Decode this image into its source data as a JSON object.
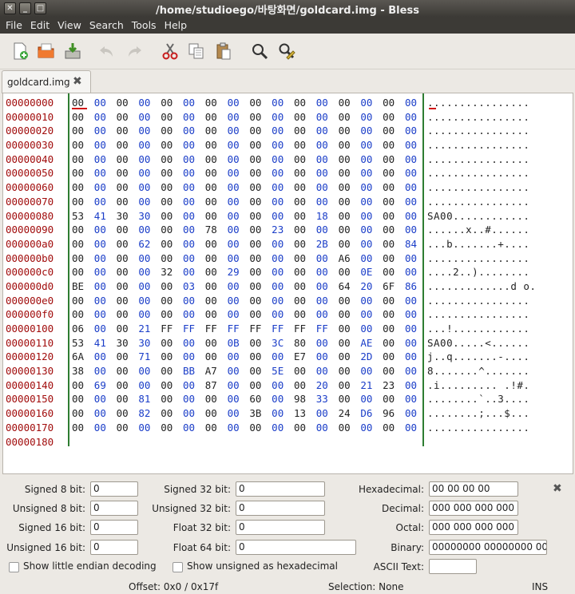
{
  "window": {
    "title": "/home/studioego/바탕화면/goldcard.img - Bless",
    "close_glyph": "✕",
    "minimize_glyph": "_",
    "maximize_glyph": "□"
  },
  "menu": [
    "File",
    "Edit",
    "View",
    "Search",
    "Tools",
    "Help"
  ],
  "toolbar": {
    "buttons": [
      {
        "name": "new-file-icon",
        "enabled": true
      },
      {
        "name": "open-file-icon",
        "enabled": true
      },
      {
        "name": "save-file-icon",
        "enabled": true
      },
      {
        "name": "undo-icon",
        "enabled": false
      },
      {
        "name": "redo-icon",
        "enabled": false
      },
      {
        "name": "cut-icon",
        "enabled": true
      },
      {
        "name": "copy-icon",
        "enabled": true
      },
      {
        "name": "paste-icon",
        "enabled": true
      },
      {
        "name": "find-icon",
        "enabled": true
      },
      {
        "name": "find-replace-icon",
        "enabled": true
      }
    ]
  },
  "tab": {
    "label": "goldcard.img",
    "close_glyph": "✖"
  },
  "hex": {
    "offsets": [
      "00000000",
      "00000010",
      "00000020",
      "00000030",
      "00000040",
      "00000050",
      "00000060",
      "00000070",
      "00000080",
      "00000090",
      "000000a0",
      "000000b0",
      "000000c0",
      "000000d0",
      "000000e0",
      "000000f0",
      "00000100",
      "00000110",
      "00000120",
      "00000130",
      "00000140",
      "00000150",
      "00000160",
      "00000170",
      "00000180"
    ],
    "rows": [
      "00 00 00 00 00 00 00 00 00 00 00 00 00 00 00 00",
      "00 00 00 00 00 00 00 00 00 00 00 00 00 00 00 00",
      "00 00 00 00 00 00 00 00 00 00 00 00 00 00 00 00",
      "00 00 00 00 00 00 00 00 00 00 00 00 00 00 00 00",
      "00 00 00 00 00 00 00 00 00 00 00 00 00 00 00 00",
      "00 00 00 00 00 00 00 00 00 00 00 00 00 00 00 00",
      "00 00 00 00 00 00 00 00 00 00 00 00 00 00 00 00",
      "00 00 00 00 00 00 00 00 00 00 00 00 00 00 00 00",
      "53 41 30 30 00 00 00 00 00 00 00 18 00 00 00 00",
      "00 00 00 00 00 00 78 00 00 23 00 00 00 00 00 00",
      "00 00 00 62 00 00 00 00 00 00 00 2B 00 00 00 84",
      "00 00 00 00 00 00 00 00 00 00 00 00 A6 00 00 00",
      "00 00 00 00 32 00 00 29 00 00 00 00 00 0E 00 00",
      "BE 00 00 00 00 03 00 00 00 00 00 00 64 20 6F 86",
      "00 00 00 00 00 00 00 00 00 00 00 00 00 00 00 00",
      "00 00 00 00 00 00 00 00 00 00 00 00 00 00 00 00",
      "06 00 00 21 FF FF FF FF FF FF FF FF 00 00 00 00",
      "53 41 30 30 00 00 00 0B 00 3C 80 00 00 AE 00 00",
      "6A 00 00 71 00 00 00 00 00 00 E7 00 00 2D 00 00",
      "38 00 00 00 00 BB A7 00 00 5E 00 00 00 00 00 00",
      "00 69 00 00 00 00 87 00 00 00 00 20 00 21 23 00",
      "00 00 00 81 00 00 00 00 60 00 98 33 00 00 00 00",
      "00 00 00 82 00 00 00 00 3B 00 13 00 24 D6 96 00",
      "00 00 00 00 00 00 00 00 00 00 00 00 00 00 00 00"
    ],
    "ascii": [
      "................",
      "................",
      "................",
      "................",
      "................",
      "................",
      "................",
      "................",
      "SA00............",
      "......x..#......",
      "...b.......+....",
      "................",
      "....2..)........",
      ".............d o.",
      "................",
      "................",
      "...!............",
      "SA00.....<......",
      "j..q.......-....",
      "8.......^.......",
      ".i......... .!#.",
      "........`..3....",
      "........;...$...",
      "................"
    ]
  },
  "converter": {
    "signed8": {
      "label": "Signed 8 bit:",
      "value": "0"
    },
    "unsigned8": {
      "label": "Unsigned 8 bit:",
      "value": "0"
    },
    "signed16": {
      "label": "Signed 16 bit:",
      "value": "0"
    },
    "unsigned16": {
      "label": "Unsigned 16 bit:",
      "value": "0"
    },
    "signed32": {
      "label": "Signed 32 bit:",
      "value": "0"
    },
    "unsigned32": {
      "label": "Unsigned 32 bit:",
      "value": "0"
    },
    "float32": {
      "label": "Float 32 bit:",
      "value": "0"
    },
    "float64": {
      "label": "Float 64 bit:",
      "value": "0"
    },
    "hexadecimal": {
      "label": "Hexadecimal:",
      "value": "00 00 00 00"
    },
    "decimal": {
      "label": "Decimal:",
      "value": "000 000 000 000"
    },
    "octal": {
      "label": "Octal:",
      "value": "000 000 000 000"
    },
    "binary": {
      "label": "Binary:",
      "value": "00000000 00000000 00000000 00000000"
    },
    "ascii": {
      "label": "ASCII Text:",
      "value": ""
    },
    "little_endian": {
      "label": "Show little endian decoding",
      "checked": false
    },
    "unsigned_hex": {
      "label": "Show unsigned as hexadecimal",
      "checked": false
    },
    "close_glyph": "✖"
  },
  "status": {
    "offset": "Offset: 0x0 / 0x17f",
    "selection": "Selection: None",
    "mode": "INS"
  },
  "colors": {
    "offset": "#a10c0c",
    "hex_alt": "#1a3dc8",
    "separator": "#2e7d32",
    "cursor": "#d01010"
  }
}
